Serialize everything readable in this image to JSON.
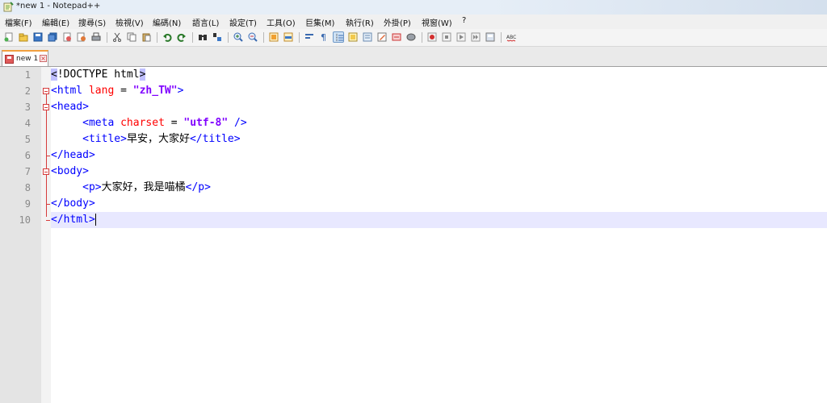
{
  "window": {
    "title": "*new 1 - Notepad++"
  },
  "menu": [
    "檔案(F)",
    "編輯(E)",
    "搜尋(S)",
    "檢視(V)",
    "編碼(N)",
    "語言(L)",
    "設定(T)",
    "工具(O)",
    "巨集(M)",
    "執行(R)",
    "外掛(P)",
    "視窗(W)",
    "?"
  ],
  "toolbar": {
    "icons": [
      "new-file-icon",
      "open-file-icon",
      "save-icon",
      "save-all-icon",
      "close-icon",
      "close-all-icon",
      "print-icon",
      "cut-icon",
      "copy-icon",
      "paste-icon",
      "undo-icon",
      "redo-icon",
      "find-icon",
      "replace-icon",
      "zoom-in-icon",
      "zoom-out-icon",
      "sync-vertical-icon",
      "sync-horizontal-icon",
      "word-wrap-icon",
      "show-all-chars-icon",
      "indent-guide-icon",
      "function-list-icon",
      "doc-map-icon",
      "folder-workspace-icon",
      "monitoring-icon",
      "clipboard-history-icon",
      "record-macro-icon",
      "stop-macro-icon",
      "play-macro-icon",
      "play-multiple-icon",
      "save-macro-icon",
      "spellcheck-icon"
    ]
  },
  "tab": {
    "label": "new 1",
    "close": "×"
  },
  "editor": {
    "lines": [
      {
        "n": "1",
        "tokens": [
          {
            "c": "t-doc hl-bg",
            "t": "<"
          },
          {
            "c": "t-doc",
            "t": "!DOCTYPE html"
          },
          {
            "c": "t-doc hl-bg",
            "t": ">"
          }
        ]
      },
      {
        "n": "2",
        "tokens": [
          {
            "c": "t-tag",
            "t": "<html "
          },
          {
            "c": "t-attr",
            "t": "lang"
          },
          {
            "c": "t-txt",
            "t": " = "
          },
          {
            "c": "t-str",
            "t": "\"zh_TW\""
          },
          {
            "c": "t-tag",
            "t": ">"
          }
        ]
      },
      {
        "n": "3",
        "tokens": [
          {
            "c": "t-tag",
            "t": "<head>"
          }
        ]
      },
      {
        "n": "4",
        "tokens": [
          {
            "c": "t-txt",
            "t": "     "
          },
          {
            "c": "t-tag",
            "t": "<meta "
          },
          {
            "c": "t-attr",
            "t": "charset"
          },
          {
            "c": "t-txt",
            "t": " = "
          },
          {
            "c": "t-str",
            "t": "\"utf-8\""
          },
          {
            "c": "t-tag",
            "t": " />"
          }
        ]
      },
      {
        "n": "5",
        "tokens": [
          {
            "c": "t-txt",
            "t": "     "
          },
          {
            "c": "t-tag",
            "t": "<title>"
          },
          {
            "c": "t-txt",
            "t": "早安，大家好"
          },
          {
            "c": "t-tag",
            "t": "</title>"
          }
        ]
      },
      {
        "n": "6",
        "tokens": [
          {
            "c": "t-tag",
            "t": "</head>"
          }
        ]
      },
      {
        "n": "7",
        "tokens": [
          {
            "c": "t-tag",
            "t": "<body>"
          }
        ]
      },
      {
        "n": "8",
        "tokens": [
          {
            "c": "t-txt",
            "t": "     "
          },
          {
            "c": "t-tag",
            "t": "<p>"
          },
          {
            "c": "t-txt",
            "t": "大家好，我是喵橘"
          },
          {
            "c": "t-tag",
            "t": "</p>"
          }
        ]
      },
      {
        "n": "9",
        "tokens": [
          {
            "c": "t-tag",
            "t": "</body>"
          }
        ]
      },
      {
        "n": "10",
        "tokens": [
          {
            "c": "t-tag",
            "t": "</html>"
          }
        ]
      }
    ],
    "current_line": 10
  },
  "colors": {
    "tag": "#0000ff",
    "attribute": "#ff0000",
    "string": "#8000ff",
    "fold_marker": "#d63b3b",
    "current_line_bg": "#e8e8ff",
    "tab_accent": "#f2a03f"
  }
}
